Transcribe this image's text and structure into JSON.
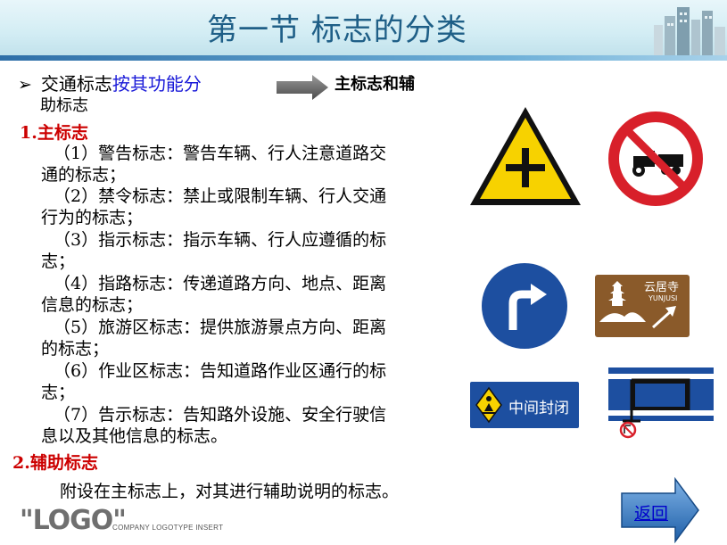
{
  "title": "第一节  标志的分类",
  "intro": {
    "bullet": "➢",
    "lead": "交通标志",
    "highlight": "按其功能分",
    "result": "主标志和辅",
    "result_cont": "助标志"
  },
  "section1": {
    "heading": "1.主标志",
    "items": [
      {
        "line1": "（1）警告标志：警告车辆、行人注意道路交",
        "line2": "通的标志；"
      },
      {
        "line1": "（2）禁令标志：禁止或限制车辆、行人交通",
        "line2": "行为的标志；"
      },
      {
        "line1": "（3）指示标志：指示车辆、行人应遵循的标",
        "line2": "志；"
      },
      {
        "line1": "（4）指路标志：传递道路方向、地点、距离",
        "line2": "信息的标志；"
      },
      {
        "line1": "（5）旅游区标志：提供旅游景点方向、距离",
        "line2": "的标志；"
      },
      {
        "line1": "（6）作业区标志：告知道路作业区通行的标",
        "line2": "志；"
      },
      {
        "line1": "（7）告示标志：告知路外设施、安全行驶信",
        "line2": "息以及其他信息的标志。"
      }
    ]
  },
  "section2": {
    "heading": "2.辅助标志",
    "note": "附设在主标志上，对其进行辅助说明的标志。"
  },
  "signs": {
    "tourist_name": "云居寺",
    "tourist_pinyin": "YUNJUSI",
    "work_zone_text": "中间封闭"
  },
  "logo": {
    "mark": "\"LOGO\"",
    "caption": "COMPANY LOGOTYPE INSERT"
  },
  "nav": {
    "back_label": "返回"
  },
  "colors": {
    "title": "#1f5f87",
    "highlight": "#1a1ad8",
    "section_heading": "#cc0000",
    "warning_yellow": "#f7d200",
    "prohibition_red": "#d8202a",
    "mandatory_blue": "#1d4fa0",
    "tourist_brown": "#8a5a2a",
    "back_button_blue": "#1e5fa8"
  }
}
